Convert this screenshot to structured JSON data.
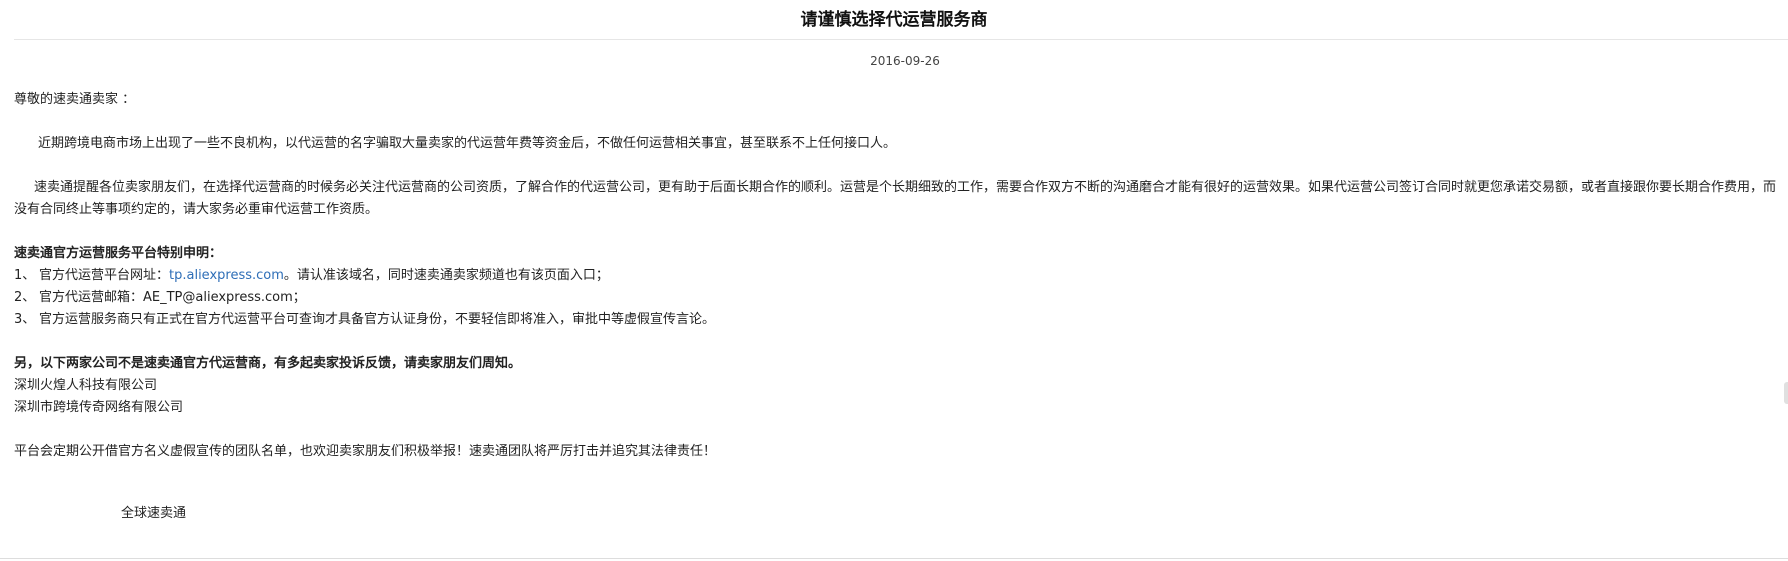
{
  "article": {
    "title": "请谨慎选择代运营服务商",
    "date": "2016-09-26",
    "greeting": "尊敬的速卖通卖家 ：",
    "paragraph1": "近期跨境电商市场上出现了一些不良机构，以代运营的名字骗取大量卖家的代运营年费等资金后，不做任何运营相关事宜，甚至联系不上任何接口人。",
    "paragraph2": "速卖通提醒各位卖家朋友们，在选择代运营商的时候务必关注代运营商的公司资质，了解合作的代运营公司，更有助于后面长期合作的顺利。运营是个长期细致的工作，需要合作双方不断的沟通磨合才能有很好的运营效果。如果代运营公司签订合同时就更您承诺交易额，或者直接跟你要长期合作费用，而没有合同终止等事项约定的，请大家务必重审代运营工作资质。",
    "statement": {
      "heading": "速卖通官方运营服务平台特别申明：",
      "items": [
        {
          "num": "1、",
          "prefix": "官方代运营平台网址：",
          "link": "tp.aliexpress.com",
          "suffix": "。请认准该域名，同时速卖通卖家频道也有该页面入口；"
        },
        {
          "num": "2、",
          "text": "官方代运营邮箱：AE_TP@aliexpress.com；"
        },
        {
          "num": "3、",
          "text": "官方运营服务商只有正式在官方代运营平台可查询才具备官方认证身份，不要轻信即将准入，审批中等虚假宣传言论。"
        }
      ]
    },
    "notice": {
      "heading": "另，以下两家公司不是速卖通官方代运营商，有多起卖家投诉反馈，请卖家朋友们周知。",
      "companies": [
        "深圳火煌人科技有限公司",
        "深圳市跨境传奇网络有限公司"
      ]
    },
    "closing": "平台会定期公开借官方名义虚假宣传的团队名单，也欢迎卖家朋友们积极举报！速卖通团队将严厉打击并追究其法律责任！",
    "signature": "全球速卖通"
  }
}
